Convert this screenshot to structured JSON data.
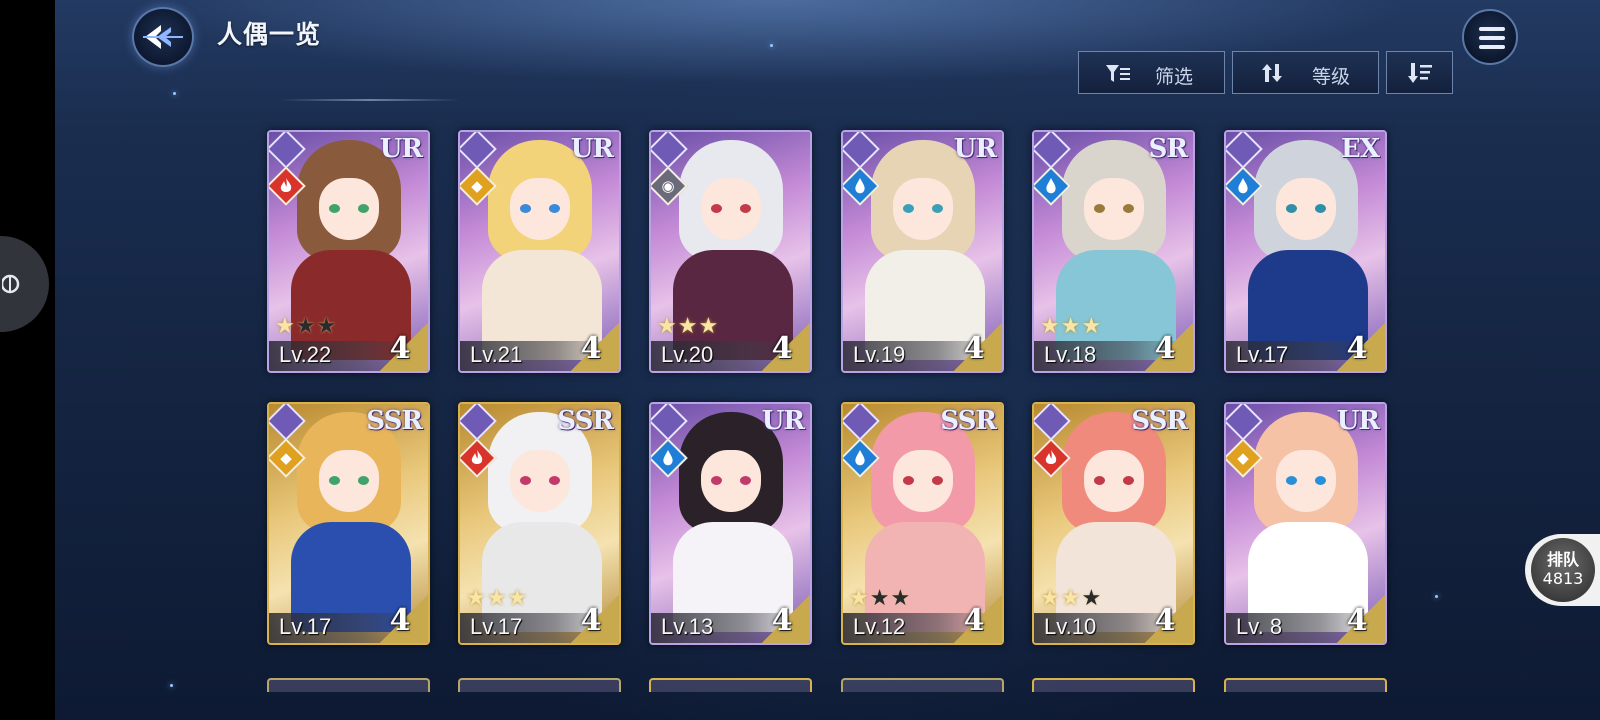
{
  "header": {
    "title": "人偶一览",
    "filter_label": "筛选",
    "sort_label": "等级"
  },
  "queue": {
    "label": "排队",
    "count": "4813"
  },
  "cards": [
    {
      "rarity": "UR",
      "level": "Lv.22",
      "count": "4",
      "stars": [
        1,
        0,
        0
      ],
      "element": "fire",
      "theme": "purple"
    },
    {
      "rarity": "UR",
      "level": "Lv.21",
      "count": "4",
      "stars": [
        0,
        0,
        0
      ],
      "element": "light",
      "theme": "purple"
    },
    {
      "rarity": "",
      "level": "Lv.20",
      "count": "4",
      "stars": [
        1,
        1,
        1
      ],
      "element": "eye",
      "theme": "purple"
    },
    {
      "rarity": "UR",
      "level": "Lv.19",
      "count": "4",
      "stars": [
        0,
        0,
        0
      ],
      "element": "water",
      "theme": "purple"
    },
    {
      "rarity": "SR",
      "level": "Lv.18",
      "count": "4",
      "stars": [
        1,
        1,
        1
      ],
      "element": "water",
      "theme": "purple"
    },
    {
      "rarity": "EX",
      "level": "Lv.17",
      "count": "4",
      "stars": [
        0,
        0,
        0
      ],
      "element": "water",
      "theme": "purple"
    },
    {
      "rarity": "SSR",
      "level": "Lv.17",
      "count": "4",
      "stars": [
        0,
        0,
        0
      ],
      "element": "light",
      "theme": "gold"
    },
    {
      "rarity": "SSR",
      "level": "Lv.17",
      "count": "4",
      "stars": [
        1,
        1,
        1
      ],
      "element": "fire",
      "theme": "gold"
    },
    {
      "rarity": "UR",
      "level": "Lv.13",
      "count": "4",
      "stars": [
        0,
        0,
        0
      ],
      "element": "water",
      "theme": "purple"
    },
    {
      "rarity": "SSR",
      "level": "Lv.12",
      "count": "4",
      "stars": [
        1,
        0,
        0
      ],
      "element": "water",
      "theme": "gold"
    },
    {
      "rarity": "SSR",
      "level": "Lv.10",
      "count": "4",
      "stars": [
        1,
        1,
        0
      ],
      "element": "fire",
      "theme": "gold"
    },
    {
      "rarity": "UR",
      "level": "Lv. 8",
      "count": "4",
      "stars": [
        0,
        0,
        0
      ],
      "element": "light",
      "theme": "purple"
    }
  ],
  "colors": {
    "background": "#142441",
    "ur_frame": "#b9a3e6",
    "ssr_frame": "#d8b24d",
    "fire": "#d9342b",
    "water": "#1f7fd6",
    "light": "#e0a020"
  }
}
